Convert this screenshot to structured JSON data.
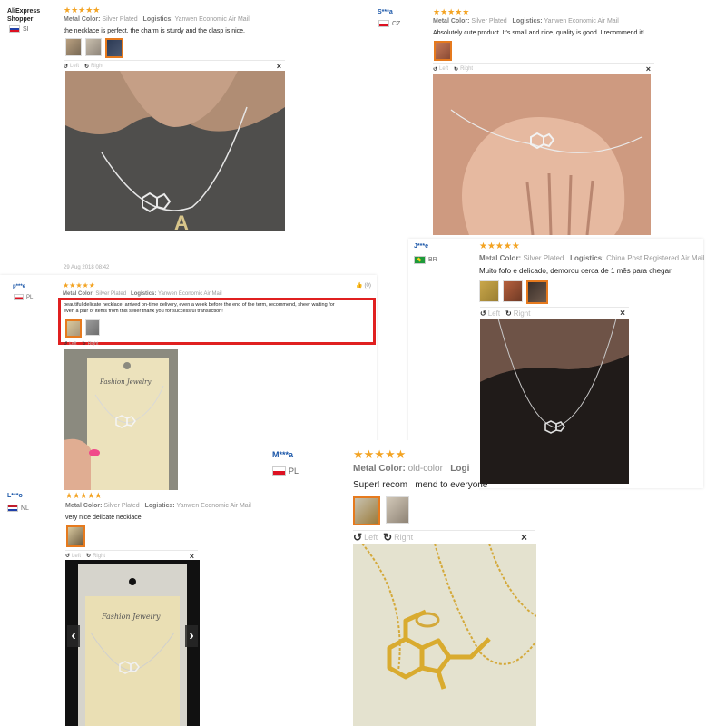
{
  "review_tl": {
    "author": "AliExpress Shopper",
    "country_code": "SI",
    "stars": "★★★★★",
    "color_label": "Metal Color:",
    "color_value": "Silver Plated",
    "logistics_label": "Logistics:",
    "logistics_value": "Yanwen Economic Air Mail",
    "text": "the necklace is perfect. the charm is sturdy and the clasp is nice.",
    "rotate_left": "Left",
    "rotate_right": "Right",
    "close": "×",
    "date": "29 Aug 2018 08:42"
  },
  "review_tr": {
    "author": "S***a",
    "country_code": "CZ",
    "stars": "★★★★★",
    "color_label": "Metal Color:",
    "color_value": "Silver Plated",
    "logistics_label": "Logistics:",
    "logistics_value": "Yanwen Economic Air Mail",
    "text": "Absolutely cute product. It's small and nice, quality is good. I recommend it!",
    "rotate_left": "Left",
    "rotate_right": "Right",
    "close": "×"
  },
  "review_pl": {
    "author": "p***e",
    "country_code": "PL",
    "stars": "★★★★★",
    "helpful_count": "(0)",
    "color_label": "Metal Color:",
    "color_value": "Silver Plated",
    "logistics_label": "Logistics:",
    "logistics_value": "Yanwen Economic Air Mail",
    "text_line1": "beautiful delicate necklace, arrived on-time delivery, even a week before the end of the term, recommend, sheer waiting for",
    "text_line2": "even a pair of items from this seller thank you for successful transaction!",
    "rotate_left": "Left",
    "rotate_right": "Right",
    "card_text": "Fashion Jewelry"
  },
  "review_br": {
    "author": "J***e",
    "country_code": "BR",
    "stars": "★★★★★",
    "color_label": "Metal Color:",
    "color_value": "Silver Plated",
    "logistics_label": "Logistics:",
    "logistics_value": "China Post Registered Air Mail",
    "text": "Muito fofo e delicado, demorou cerca de 1 mês para chegar.",
    "rotate_left": "Left",
    "rotate_right": "Right",
    "close": "×"
  },
  "review_nl": {
    "author": "L***o",
    "country_code": "NL",
    "stars": "★★★★★",
    "color_label": "Metal Color:",
    "color_value": "Silver Plated",
    "logistics_label": "Logistics:",
    "logistics_value": "Yanwen Economic Air Mail",
    "text": "very nice delicate necklace!",
    "rotate_left": "Left",
    "rotate_right": "Right",
    "close": "×",
    "prev": "‹",
    "next": "›",
    "card_text": "Fashion Jewelry"
  },
  "review_m": {
    "author": "M***a",
    "country_code": "PL",
    "stars": "★★★★★",
    "color_label": "Metal Color:",
    "color_value": "old-color",
    "logistics_label": "Logi",
    "text": "Super! recom   mend to everyone",
    "rotate_left": "Left",
    "rotate_right": "Right",
    "close": "×"
  }
}
